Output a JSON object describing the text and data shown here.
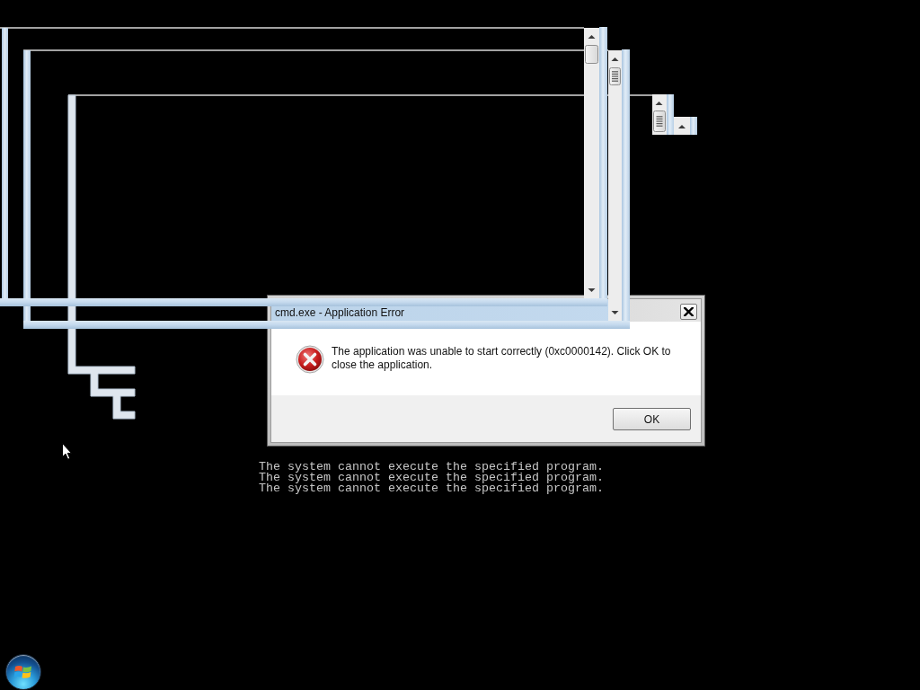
{
  "dialog": {
    "title": "cmd.exe - Application Error",
    "message": "The application was unable to start correctly (0xc0000142). Click OK to close the application.",
    "buttons": [
      "OK"
    ]
  },
  "console": {
    "lines": [
      "The system cannot execute the specified program.",
      "The system cannot execute the specified program.",
      "The system cannot execute the specified program."
    ]
  }
}
